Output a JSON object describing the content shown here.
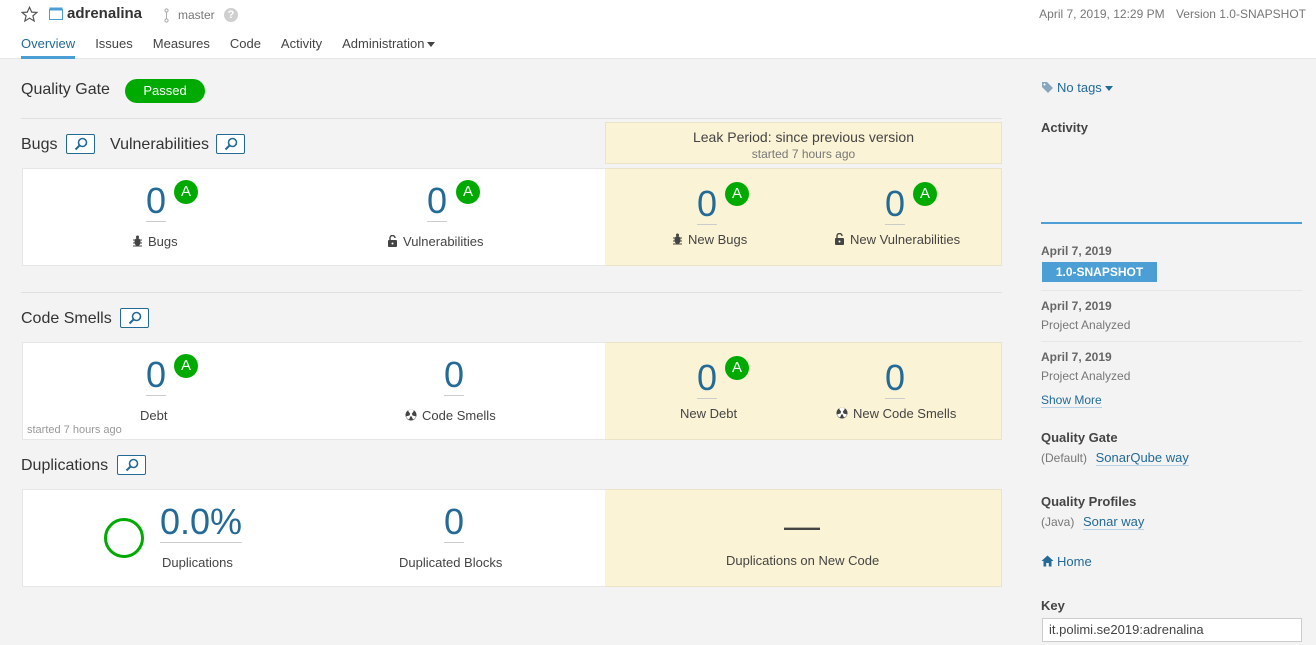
{
  "header": {
    "project_name": "adrenalina",
    "branch": "master",
    "help": "?",
    "analysis_date": "April 7, 2019, 12:29 PM",
    "version": "Version 1.0-SNAPSHOT"
  },
  "nav": {
    "tabs": [
      "Overview",
      "Issues",
      "Measures",
      "Code",
      "Activity",
      "Administration"
    ],
    "active": "Overview"
  },
  "quality_gate": {
    "title": "Quality Gate",
    "status": "Passed",
    "status_color": "#00aa00"
  },
  "leak": {
    "title": "Leak Period: since previous version",
    "started": "started 7 hours ago"
  },
  "bugs_section": {
    "bugs_title": "Bugs",
    "vuln_title": "Vulnerabilities",
    "bugs": {
      "value": "0",
      "rating": "A",
      "label": "Bugs"
    },
    "vulnerabilities": {
      "value": "0",
      "rating": "A",
      "label": "Vulnerabilities"
    },
    "new_bugs": {
      "value": "0",
      "rating": "A",
      "label": "New Bugs"
    },
    "new_vulnerabilities": {
      "value": "0",
      "rating": "A",
      "label": "New Vulnerabilities"
    }
  },
  "code_smells_section": {
    "title": "Code Smells",
    "debt": {
      "value": "0",
      "rating": "A",
      "label": "Debt",
      "note": "started 7 hours ago"
    },
    "code_smells": {
      "value": "0",
      "label": "Code Smells"
    },
    "new_debt": {
      "value": "0",
      "rating": "A",
      "label": "New Debt"
    },
    "new_code_smells": {
      "value": "0",
      "label": "New Code Smells"
    }
  },
  "duplications_section": {
    "title": "Duplications",
    "duplications": {
      "value": "0.0%",
      "label": "Duplications"
    },
    "duplicated_blocks": {
      "value": "0",
      "label": "Duplicated Blocks"
    },
    "new_duplications": {
      "value": "—",
      "label": "Duplications on New Code"
    }
  },
  "sidebar": {
    "tags": "No tags",
    "activity_title": "Activity",
    "events": [
      {
        "date": "April 7, 2019",
        "badge": "1.0-SNAPSHOT"
      },
      {
        "date": "April 7, 2019",
        "text": "Project Analyzed"
      },
      {
        "date": "April 7, 2019",
        "text": "Project Analyzed"
      }
    ],
    "show_more": "Show More",
    "quality_gate_title": "Quality Gate",
    "quality_gate_qualifier": "(Default)",
    "quality_gate_name": "SonarQube way",
    "quality_profiles_title": "Quality Profiles",
    "profile_language": "(Java)",
    "profile_name": "Sonar way",
    "home_link": "Home",
    "key_title": "Key",
    "key_value": "it.polimi.se2019:adrenalina"
  },
  "colors": {
    "accent": "#236a97",
    "rating_a": "#00aa00",
    "leak_bg": "#fbf3d5",
    "badge_blue": "#4b9fd5"
  }
}
